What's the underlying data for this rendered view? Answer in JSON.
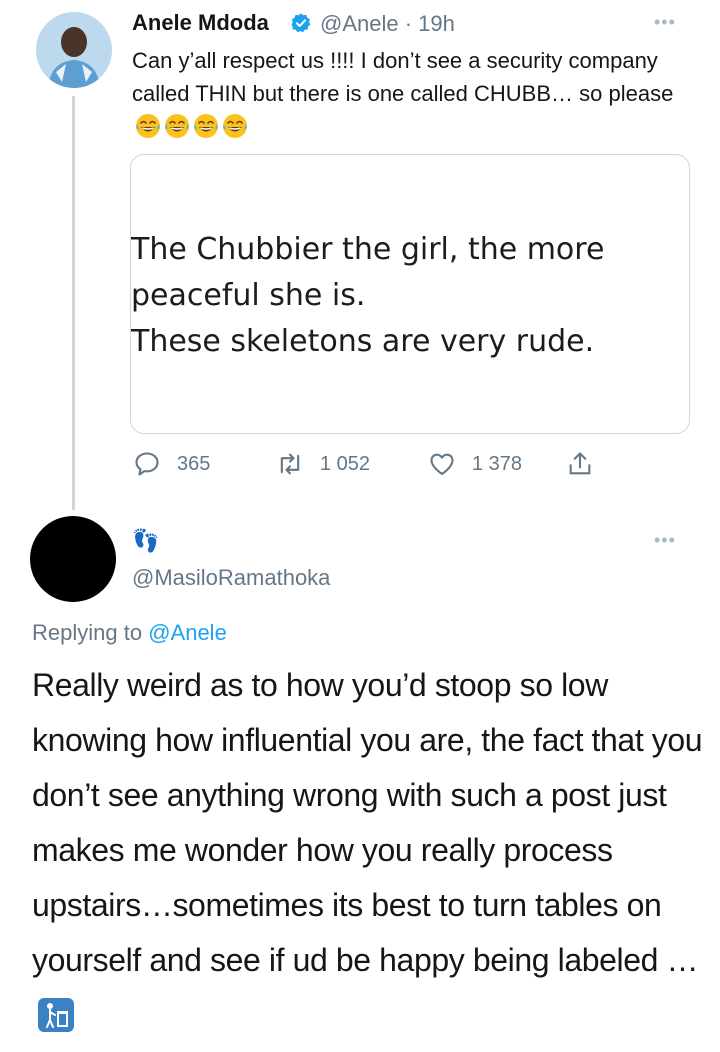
{
  "original_tweet": {
    "author_name": "Anele Mdoda",
    "handle": "@Anele",
    "time": "· 19h",
    "text": "Can y’all respect us !!!! I don’t see a security company called THIN but there is one called CHUBB… so please",
    "emoji_count": 4,
    "emoji_name": "face-with-tears-of-joy",
    "quoted_image_lines": [
      "The Chubbier the girl, the more",
      "peaceful she is.",
      "These skeletons are very rude."
    ],
    "actions": {
      "replies": "365",
      "retweets": "1 052",
      "likes": "1 378"
    },
    "more_label": "•••",
    "verified_color": "#1da1f2"
  },
  "reply_tweet": {
    "display_name_icon": "👣",
    "handle": "@MasiloRamathoka",
    "more_label": "•••",
    "replying_prefix": "Replying to",
    "replying_handle": "@Anele",
    "text": "Really weird as to how you’d stoop so low knowing how influential you are, the fact that you don’t see anything wrong with such a post just makes me wonder how you really process upstairs…sometimes its best to turn tables on yourself and see if ud be happy being labeled …",
    "trailing_icon": "put-litter-in-its-place-icon"
  },
  "colors": {
    "text": "#14171a",
    "secondary": "#657786",
    "link": "#1da1f2",
    "border": "#ccd6dd"
  }
}
